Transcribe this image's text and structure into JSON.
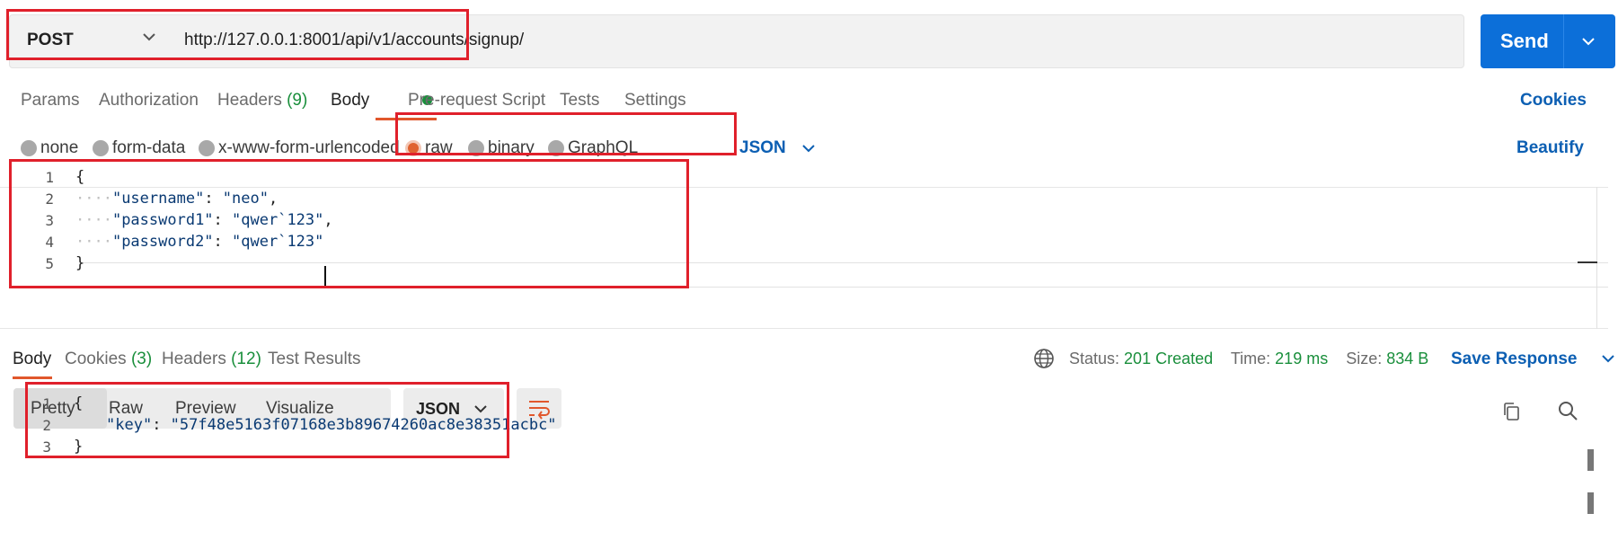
{
  "request": {
    "method": "POST",
    "url": "http://127.0.0.1:8001/api/v1/accounts/signup/",
    "send_label": "Send"
  },
  "request_tabs": [
    {
      "label": "Params"
    },
    {
      "label": "Authorization"
    },
    {
      "label": "Headers",
      "count": "(9)"
    },
    {
      "label": "Body"
    },
    {
      "label": "Pre-request Script"
    },
    {
      "label": "Tests"
    },
    {
      "label": "Settings"
    }
  ],
  "cookies_label": "Cookies",
  "body_types": [
    {
      "label": "none"
    },
    {
      "label": "form-data"
    },
    {
      "label": "x-www-form-urlencoded"
    },
    {
      "label": "raw"
    },
    {
      "label": "binary"
    },
    {
      "label": "GraphQL"
    }
  ],
  "body_format": "JSON",
  "beautify_label": "Beautify",
  "request_body": {
    "line_numbers": [
      "1",
      "2",
      "3",
      "4",
      "5"
    ],
    "open_brace": "{",
    "close_brace": "}",
    "fields": [
      {
        "key": "\"username\"",
        "value": "\"neo\"",
        "comma": ","
      },
      {
        "key": "\"password1\"",
        "value": "\"qwer`123\"",
        "comma": ","
      },
      {
        "key": "\"password2\"",
        "value": "\"qwer`123\"",
        "comma": ""
      }
    ]
  },
  "response_tabs": [
    {
      "label": "Body"
    },
    {
      "label": "Cookies",
      "count": "(3)"
    },
    {
      "label": "Headers",
      "count": "(12)"
    },
    {
      "label": "Test Results"
    }
  ],
  "response_status": {
    "status_label": "Status:",
    "status_value": "201 Created",
    "time_label": "Time:",
    "time_value": "219 ms",
    "size_label": "Size:",
    "size_value": "834 B"
  },
  "save_response_label": "Save Response",
  "view_modes": [
    {
      "label": "Pretty"
    },
    {
      "label": "Raw"
    },
    {
      "label": "Preview"
    },
    {
      "label": "Visualize"
    }
  ],
  "response_format": "JSON",
  "response_body": {
    "line_numbers": [
      "1",
      "2",
      "3"
    ],
    "open_brace": "{",
    "close_brace": "}",
    "key": "\"key\"",
    "value": "\"57f48e5163f07168e3b89674260ac8e38351acbc\""
  },
  "colors": {
    "accent": "#e1572c",
    "primary": "#0c6fd9",
    "link": "#0c5fb3",
    "success": "#1a8f3c",
    "highlight_box": "#e0202b"
  }
}
